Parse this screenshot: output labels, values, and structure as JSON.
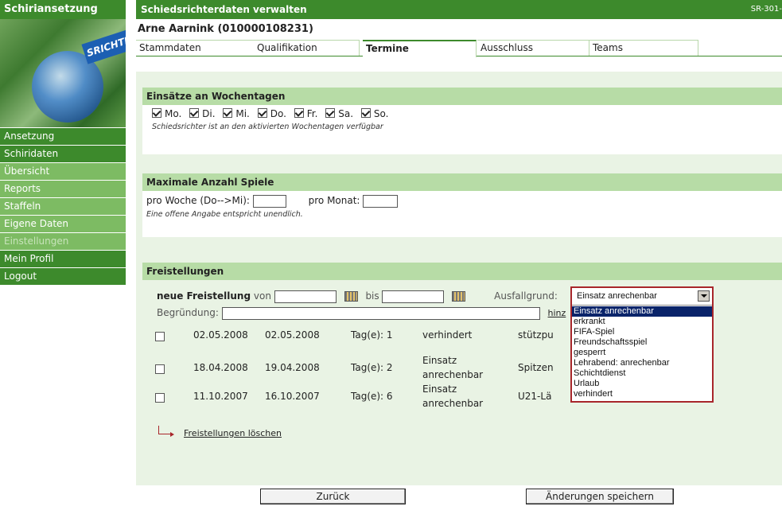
{
  "sidebar": {
    "title": "Schiriansetzung",
    "logo_text": "SRICHTI",
    "items": [
      {
        "label": "Ansetzung",
        "style": "dark"
      },
      {
        "label": "Schiridaten",
        "style": "dark"
      },
      {
        "label": "Übersicht",
        "style": "light"
      },
      {
        "label": "Reports",
        "style": "light"
      },
      {
        "label": "Staffeln",
        "style": "light"
      },
      {
        "label": "Eigene Daten",
        "style": "light"
      },
      {
        "label": "Einstellungen",
        "style": "disabled"
      },
      {
        "label": "Mein Profil",
        "style": "dark"
      },
      {
        "label": "Logout",
        "style": "dark"
      }
    ]
  },
  "header": {
    "title": "Schiedsrichterdaten verwalten",
    "code": "SR-301-"
  },
  "person": "Arne Aarnink (010000108231)",
  "tabs": [
    "Stammdaten",
    "Qualifikation",
    "Termine",
    "Ausschluss",
    "Teams"
  ],
  "active_tab": "Termine",
  "weekdays": {
    "title": "Einsätze an Wochentagen",
    "days": [
      {
        "label": "Mo.",
        "checked": true
      },
      {
        "label": "Di.",
        "checked": true
      },
      {
        "label": "Mi.",
        "checked": true
      },
      {
        "label": "Do.",
        "checked": true
      },
      {
        "label": "Fr.",
        "checked": true
      },
      {
        "label": "Sa.",
        "checked": true
      },
      {
        "label": "So.",
        "checked": true
      }
    ],
    "note": "Schiedsrichter ist an den aktivierten Wochentagen verfügbar"
  },
  "max_games": {
    "title": "Maximale Anzahl Spiele",
    "per_week_label": "pro Woche (Do-->Mi):",
    "per_week_value": "",
    "per_month_label": "pro Monat:",
    "per_month_value": "",
    "note": "Eine offene Angabe entspricht unendlich."
  },
  "freistellungen": {
    "title": "Freistellungen",
    "new_label": "neue Freistellung",
    "von_label": "von",
    "bis_label": "bis",
    "von_value": "",
    "bis_value": "",
    "reason_label": "Ausfallgrund:",
    "reason_selected": "Einsatz anrechenbar",
    "reason_options": [
      "Einsatz anrechenbar",
      "erkrankt",
      "FIFA-Spiel",
      "Freundschaftsspiel",
      "gesperrt",
      "Lehrabend: anrechenbar",
      "Schichtdienst",
      "Urlaub",
      "verhindert"
    ],
    "begruendung_label": "Begründung:",
    "begruendung_value": "",
    "add_link": "hinz",
    "rows": [
      {
        "from": "02.05.2008",
        "to": "02.05.2008",
        "days": "Tag(e): 1",
        "reason": "verhindert",
        "reason2": "",
        "comment": "stützpu"
      },
      {
        "from": "18.04.2008",
        "to": "19.04.2008",
        "days": "Tag(e): 2",
        "reason": "Einsatz",
        "reason2": "anrechenbar",
        "comment": "Spitzen"
      },
      {
        "from": "11.10.2007",
        "to": "16.10.2007",
        "days": "Tag(e): 6",
        "reason": "Einsatz",
        "reason2": "anrechenbar",
        "comment": "U21-Lä"
      }
    ],
    "delete_link": "Freistellungen löschen"
  },
  "buttons": {
    "back": "Zurück",
    "save": "Änderungen speichern"
  }
}
